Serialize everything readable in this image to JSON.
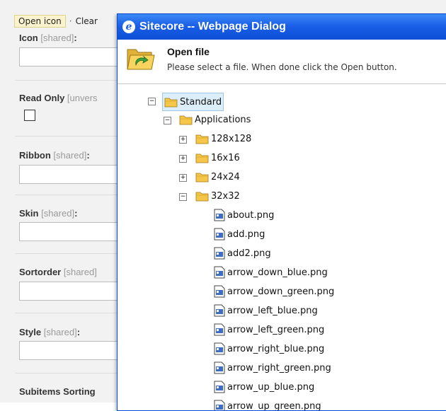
{
  "editor": {
    "open_icon_label": "Open icon",
    "separator": "·",
    "clear_label": "Clear",
    "fields": [
      {
        "name": "Icon",
        "tag": "[shared]",
        "suffix": ":"
      },
      {
        "name": "Read Only",
        "tag": "[unvers",
        "suffix": ""
      },
      {
        "name": "Ribbon",
        "tag": "[shared]",
        "suffix": ":"
      },
      {
        "name": "Skin",
        "tag": "[shared]",
        "suffix": ":"
      },
      {
        "name": "Sortorder",
        "tag": "[shared]",
        "suffix": ""
      },
      {
        "name": "Style",
        "tag": "[shared]",
        "suffix": ":"
      },
      {
        "name": "Subitems Sorting",
        "tag": "",
        "suffix": ""
      }
    ]
  },
  "dialog": {
    "title": "Sitecore -- Webpage Dialog",
    "header_title": "Open file",
    "header_desc": "Please select a file. When done click the Open button.",
    "tree": {
      "root": "Standard",
      "applications": "Applications",
      "folders": [
        "128x128",
        "16x16",
        "24x24",
        "32x32"
      ],
      "files": [
        "about.png",
        "add.png",
        "add2.png",
        "arrow_down_blue.png",
        "arrow_down_green.png",
        "arrow_left_blue.png",
        "arrow_left_green.png",
        "arrow_right_blue.png",
        "arrow_right_green.png",
        "arrow_up_blue.png",
        "arrow_up_green.png"
      ],
      "expand_symbol": "+",
      "collapse_symbol": "−"
    }
  },
  "colors": {
    "titlebar": "#1b5fe8",
    "selection": "#ddeefb",
    "folder": "#f5c64a"
  },
  "icons": {
    "folder": "folder-icon",
    "file": "file-icon",
    "ie": "ie-icon"
  }
}
